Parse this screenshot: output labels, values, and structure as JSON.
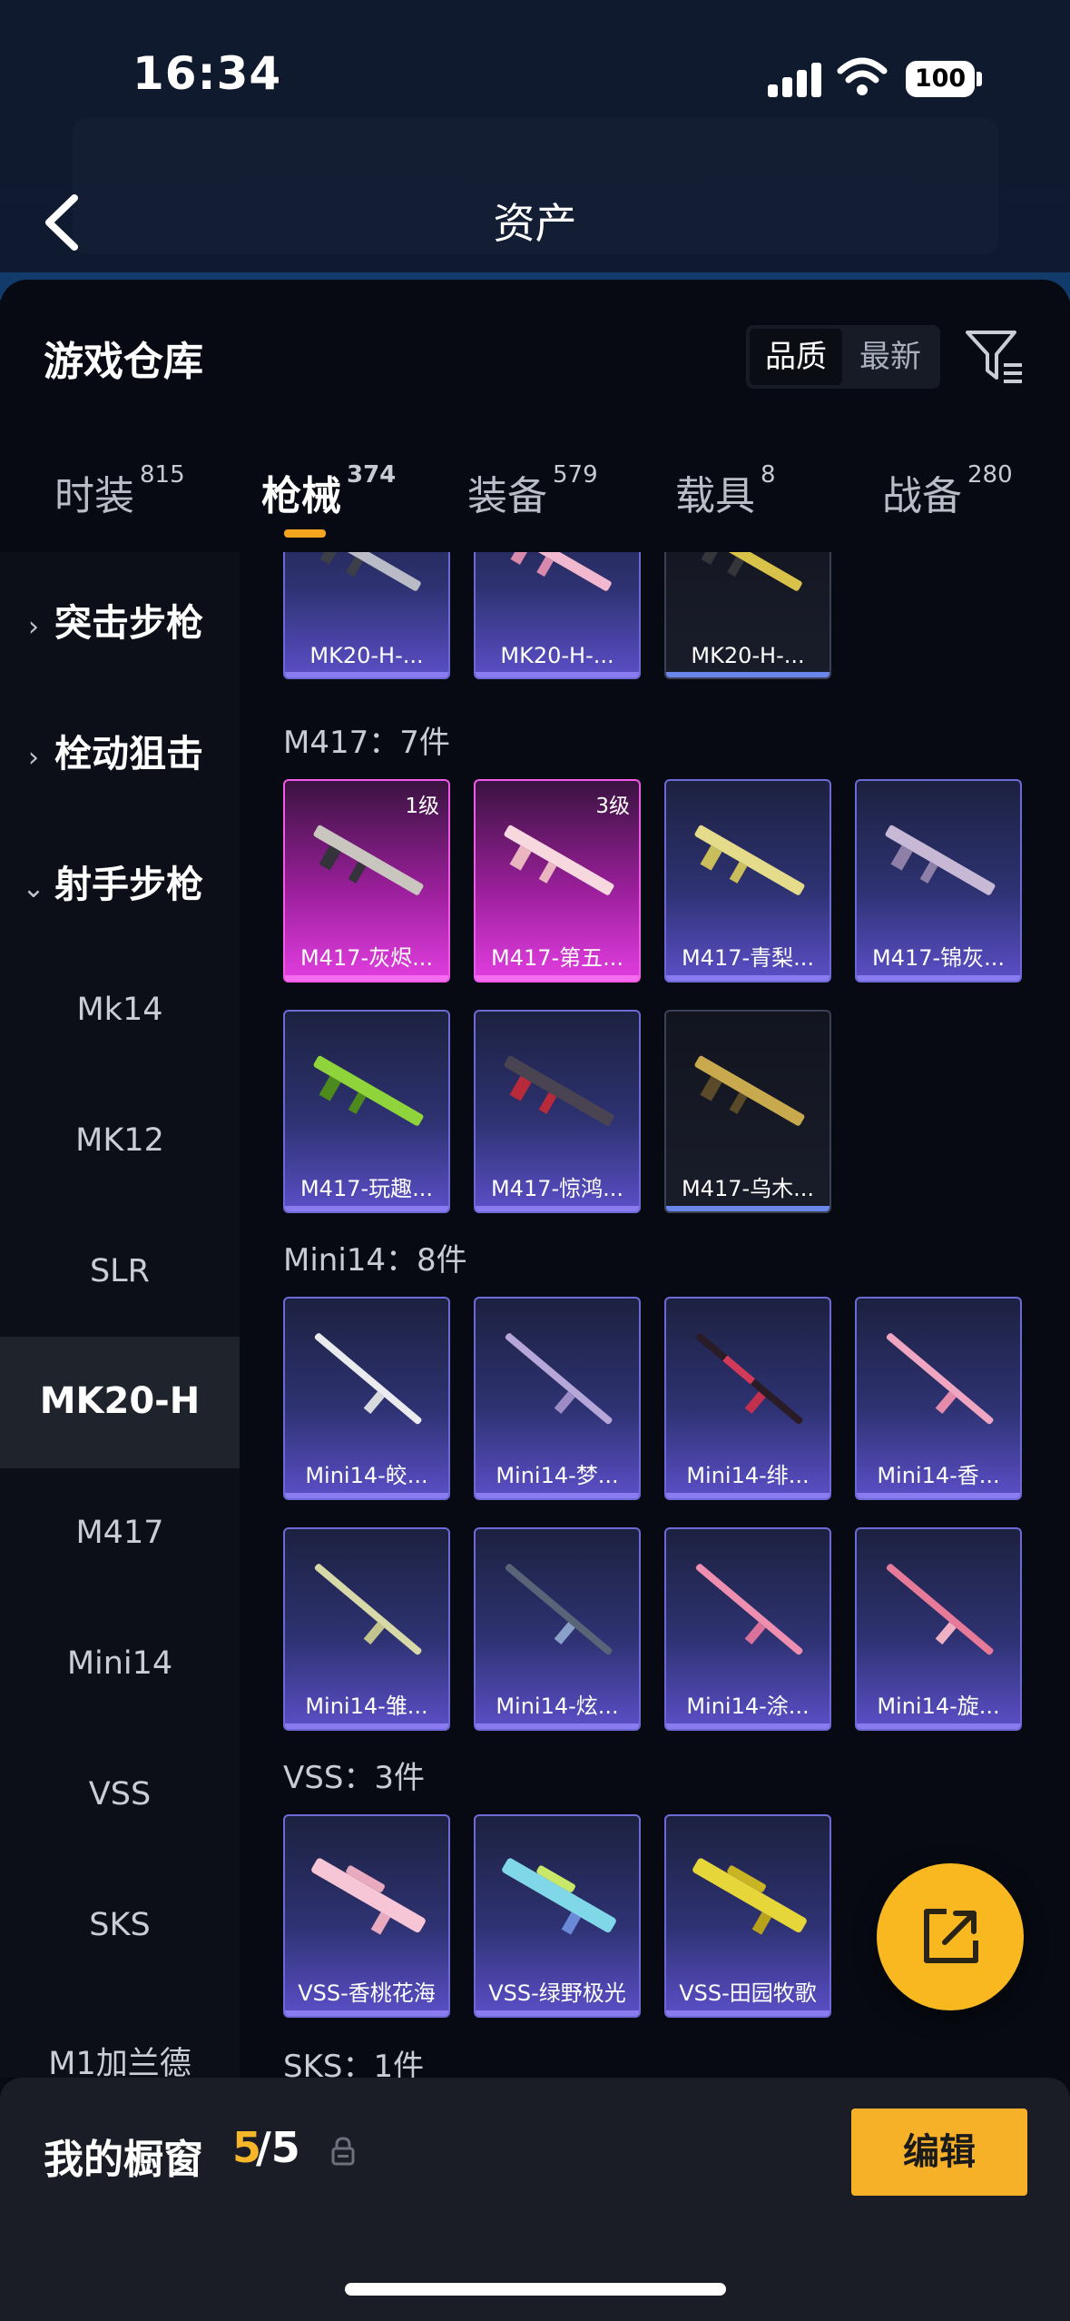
{
  "status": {
    "time": "16:34",
    "battery": "100"
  },
  "nav": {
    "title": "资产"
  },
  "warehouse": {
    "title": "游戏仓库",
    "sort_quality": "品质",
    "sort_newest": "最新"
  },
  "tabs": [
    {
      "label": "时装",
      "count": "815"
    },
    {
      "label": "枪械",
      "count": "374"
    },
    {
      "label": "装备",
      "count": "579"
    },
    {
      "label": "载具",
      "count": "8"
    },
    {
      "label": "战备",
      "count": "280"
    }
  ],
  "sidebar": {
    "categories": [
      "突击步枪",
      "栓动狙击",
      "射手步枪"
    ],
    "items": [
      "Mk14",
      "MK12",
      "SLR",
      "MK20-H",
      "M417",
      "Mini14",
      "VSS",
      "SKS",
      "M1加兰德"
    ]
  },
  "groups": {
    "mk20": {
      "items": [
        {
          "name": "MK20-H-..."
        },
        {
          "name": "MK20-H-..."
        },
        {
          "name": "MK20-H-..."
        }
      ]
    },
    "m417": {
      "header": "M417：7件",
      "items": [
        {
          "name": "M417-灰烬...",
          "level": "1级"
        },
        {
          "name": "M417-第五...",
          "level": "3级"
        },
        {
          "name": "M417-青梨..."
        },
        {
          "name": "M417-锦灰..."
        },
        {
          "name": "M417-玩趣..."
        },
        {
          "name": "M417-惊鸿..."
        },
        {
          "name": "M417-乌木..."
        }
      ]
    },
    "mini14": {
      "header": "Mini14：8件",
      "items": [
        {
          "name": "Mini14-皎..."
        },
        {
          "name": "Mini14-梦..."
        },
        {
          "name": "Mini14-绯..."
        },
        {
          "name": "Mini14-香..."
        },
        {
          "name": "Mini14-雏..."
        },
        {
          "name": "Mini14-炫..."
        },
        {
          "name": "Mini14-涂..."
        },
        {
          "name": "Mini14-旋..."
        }
      ]
    },
    "vss": {
      "header": "VSS：3件",
      "items": [
        {
          "name": "VSS-香桃花海"
        },
        {
          "name": "VSS-绿野极光"
        },
        {
          "name": "VSS-田园牧歌"
        }
      ]
    },
    "sks": {
      "header": "SKS：1件"
    }
  },
  "showcase": {
    "title": "我的橱窗",
    "count": "5",
    "total": "/5",
    "edit_label": "编辑"
  },
  "colors": {
    "accent": "#f6b128",
    "rarity_epic": "#6d6ad6",
    "rarity_legendary": "#f15ae6"
  },
  "icons": {
    "back": "chevron-left-icon",
    "filter": "filter-icon",
    "share": "share-icon",
    "lock": "lock-icon",
    "expand": "chevron-right-icon",
    "collapse": "chevron-down-icon"
  }
}
